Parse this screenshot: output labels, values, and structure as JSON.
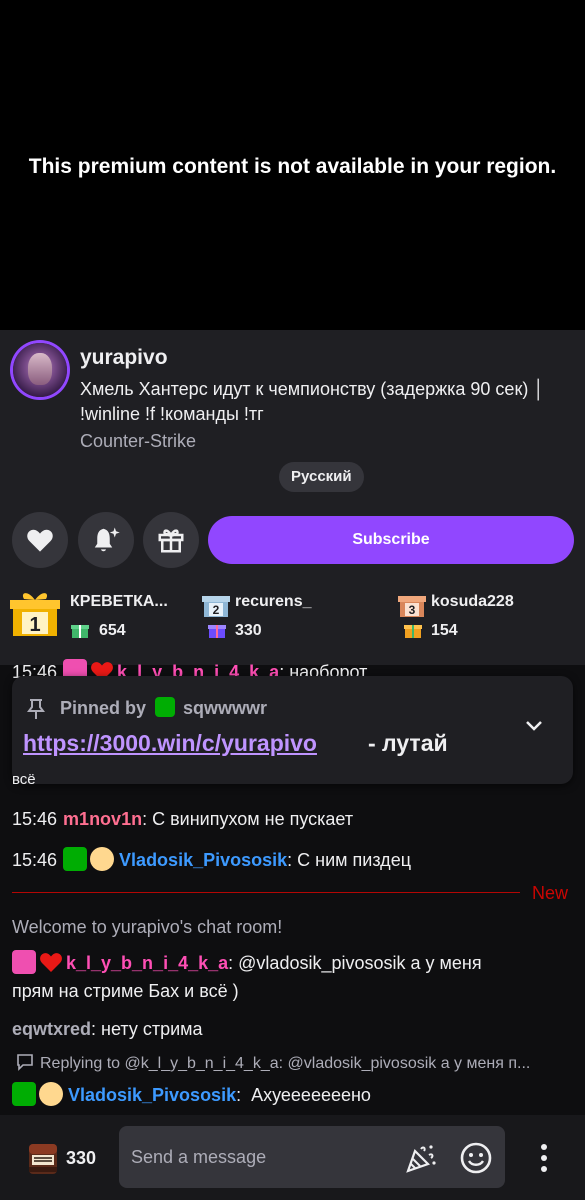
{
  "player": {
    "message": "This premium content is not available in your region."
  },
  "channel": {
    "name": "yurapivo",
    "title": "Хмель Хантерс идут к чемпионству (задержка 90 сек) │ !winline !f !команды !тг",
    "game": "Counter-Strike",
    "language_tag": "Русский"
  },
  "actions": {
    "follow_icon": "heart-icon",
    "notify_icon": "bell-icon",
    "gift_icon": "gift-icon",
    "subscribe_label": "Subscribe"
  },
  "top_gifters": [
    {
      "rank": "1",
      "name": "КРЕВЕТКА...",
      "count": "654"
    },
    {
      "rank": "2",
      "name": "recurens_",
      "count": "330"
    },
    {
      "rank": "3",
      "name": "kosuda228",
      "count": "154"
    }
  ],
  "pinned": {
    "by_label": "Pinned by",
    "by_user": "sqwwwwr",
    "link": "https://3000.win/c/yurapivo",
    "suffix": "- лутай"
  },
  "chat": {
    "messages": [
      {
        "time": "15:46",
        "user": "k_l_y_b_n_i_4_k_a",
        "text": "наоборот",
        "user_color": "#ff4fb5"
      },
      {
        "text": "всё"
      },
      {
        "time": "15:46",
        "user": "m1nov1n",
        "text": "С винипухом не пускает",
        "user_color": "#ff6f91"
      },
      {
        "time": "15:46",
        "user": "Vladosik_Pivososik",
        "text": "С ним пиздец",
        "user_color": "#3d9aff"
      }
    ],
    "new_label": "New",
    "welcome": "Welcome to yurapivo's chat room!",
    "after_new": [
      {
        "user": "k_l_y_b_n_i_4_k_a",
        "text": "@vladosik_pivososik а у меня",
        "text_line2": "прям на стриме Бах и всё )",
        "user_color": "#ff4fb5"
      },
      {
        "user": "eqwtxred",
        "text": "нету стрима",
        "user_color": "#adadb8"
      }
    ],
    "reply_context": "Replying to @k_l_y_b_n_i_4_k_a: @vladosik_pivososik а у меня п...",
    "reply": {
      "user": "Vladosik_Pivososik",
      "text": "Ахуееееееено",
      "user_color": "#3d9aff"
    }
  },
  "composer": {
    "bits_count": "330",
    "placeholder": "Send a message"
  }
}
